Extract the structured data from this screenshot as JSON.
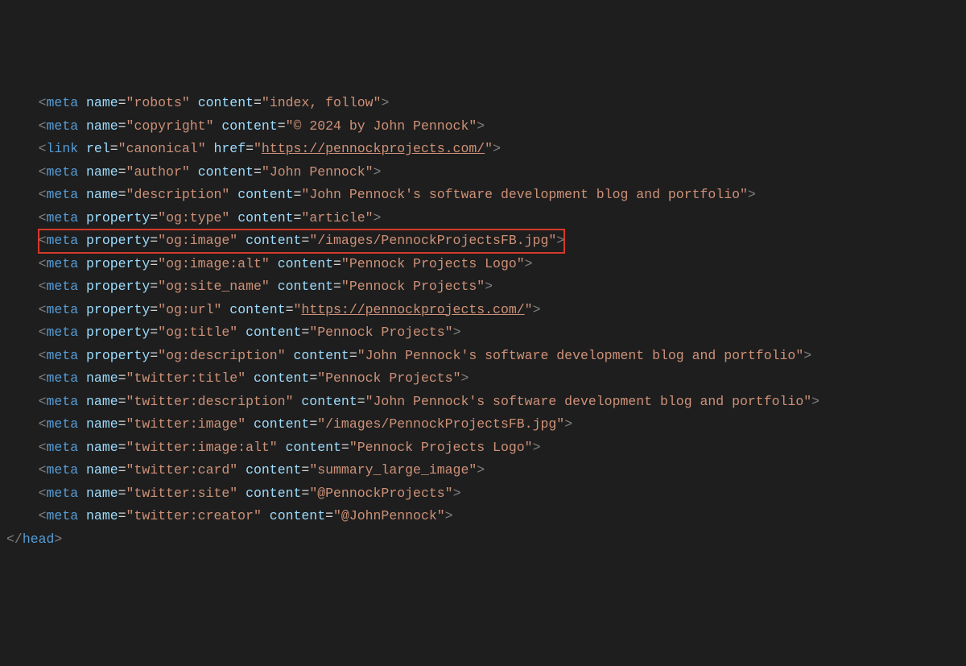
{
  "lines": [
    {
      "indent": 2,
      "tag": "meta",
      "attrs": [
        {
          "name": "name",
          "value": "robots"
        },
        {
          "name": "content",
          "value": "index, follow"
        }
      ]
    },
    {
      "indent": 2,
      "tag": "meta",
      "attrs": [
        {
          "name": "name",
          "value": "copyright"
        },
        {
          "name": "content",
          "value": "© 2024 by John Pennock"
        }
      ]
    },
    {
      "indent": 2,
      "tag": "link",
      "attrs": [
        {
          "name": "rel",
          "value": "canonical"
        },
        {
          "name": "href",
          "value": "https://pennockprojects.com/",
          "isUrl": true
        }
      ]
    },
    {
      "indent": 2,
      "tag": "meta",
      "attrs": [
        {
          "name": "name",
          "value": "author"
        },
        {
          "name": "content",
          "value": "John Pennock"
        }
      ]
    },
    {
      "indent": 2,
      "tag": "meta",
      "attrs": [
        {
          "name": "name",
          "value": "description"
        },
        {
          "name": "content",
          "value": "John Pennock's software development blog and portfolio"
        }
      ]
    },
    {
      "indent": 2,
      "tag": "meta",
      "attrs": [
        {
          "name": "property",
          "value": "og:type"
        },
        {
          "name": "content",
          "value": "article"
        }
      ]
    },
    {
      "indent": 2,
      "highlighted": true,
      "tag": "meta",
      "attrs": [
        {
          "name": "property",
          "value": "og:image"
        },
        {
          "name": "content",
          "value": "/images/PennockProjectsFB.jpg"
        }
      ]
    },
    {
      "indent": 2,
      "tag": "meta",
      "attrs": [
        {
          "name": "property",
          "value": "og:image:alt"
        },
        {
          "name": "content",
          "value": "Pennock Projects Logo"
        }
      ]
    },
    {
      "indent": 2,
      "tag": "meta",
      "attrs": [
        {
          "name": "property",
          "value": "og:site_name"
        },
        {
          "name": "content",
          "value": "Pennock Projects"
        }
      ]
    },
    {
      "indent": 2,
      "tag": "meta",
      "attrs": [
        {
          "name": "property",
          "value": "og:url"
        },
        {
          "name": "content",
          "value": "https://pennockprojects.com/",
          "isUrl": true
        }
      ]
    },
    {
      "indent": 2,
      "tag": "meta",
      "attrs": [
        {
          "name": "property",
          "value": "og:title"
        },
        {
          "name": "content",
          "value": "Pennock Projects"
        }
      ]
    },
    {
      "indent": 2,
      "tag": "meta",
      "attrs": [
        {
          "name": "property",
          "value": "og:description"
        },
        {
          "name": "content",
          "value": "John Pennock's software development blog and portfolio"
        }
      ]
    },
    {
      "indent": 2,
      "tag": "meta",
      "attrs": [
        {
          "name": "name",
          "value": "twitter:title"
        },
        {
          "name": "content",
          "value": "Pennock Projects"
        }
      ]
    },
    {
      "indent": 2,
      "tag": "meta",
      "attrs": [
        {
          "name": "name",
          "value": "twitter:description"
        },
        {
          "name": "content",
          "value": "John Pennock's software development blog and portfolio"
        }
      ]
    },
    {
      "indent": 2,
      "tag": "meta",
      "attrs": [
        {
          "name": "name",
          "value": "twitter:image"
        },
        {
          "name": "content",
          "value": "/images/PennockProjectsFB.jpg"
        }
      ]
    },
    {
      "indent": 2,
      "tag": "meta",
      "attrs": [
        {
          "name": "name",
          "value": "twitter:image:alt"
        },
        {
          "name": "content",
          "value": "Pennock Projects Logo"
        }
      ]
    },
    {
      "indent": 2,
      "tag": "meta",
      "attrs": [
        {
          "name": "name",
          "value": "twitter:card"
        },
        {
          "name": "content",
          "value": "summary_large_image"
        }
      ]
    },
    {
      "indent": 2,
      "tag": "meta",
      "attrs": [
        {
          "name": "name",
          "value": "twitter:site"
        },
        {
          "name": "content",
          "value": "@PennockProjects"
        }
      ]
    },
    {
      "indent": 2,
      "tag": "meta",
      "attrs": [
        {
          "name": "name",
          "value": "twitter:creator"
        },
        {
          "name": "content",
          "value": "@JohnPennock"
        }
      ]
    }
  ],
  "closingTag": "head"
}
